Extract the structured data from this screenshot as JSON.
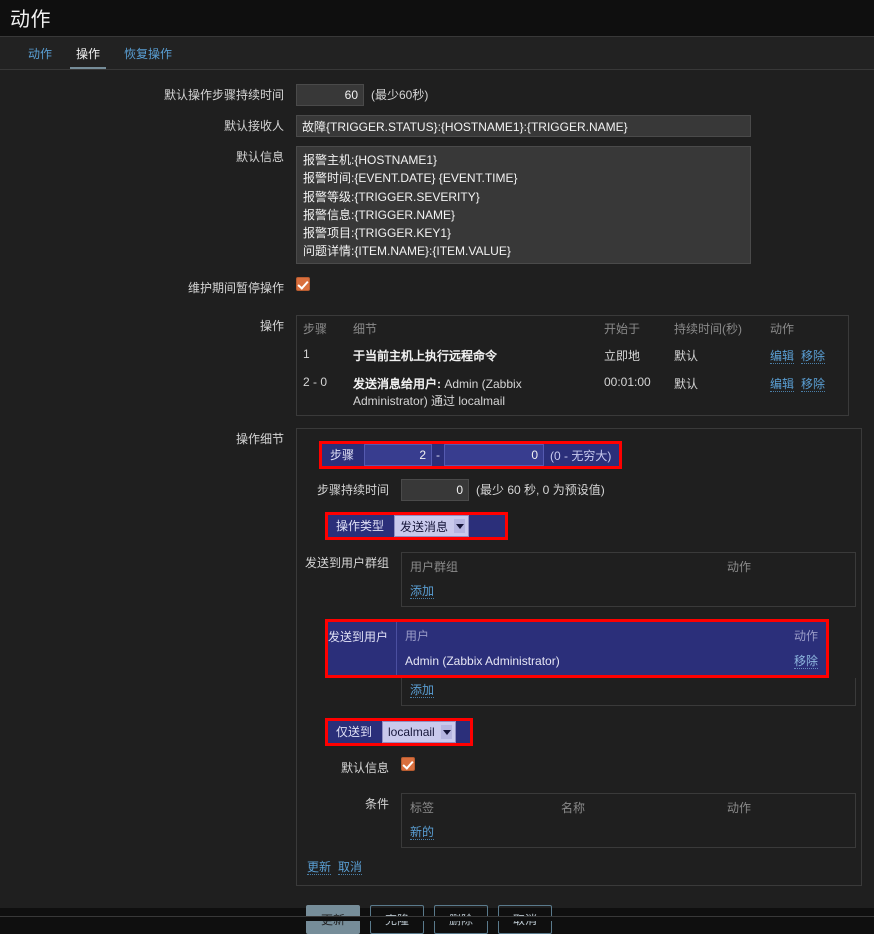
{
  "page": {
    "title": "动作"
  },
  "tabs": [
    {
      "label": "动作",
      "active": false
    },
    {
      "label": "操作",
      "active": true
    },
    {
      "label": "恢复操作",
      "active": false
    }
  ],
  "form": {
    "default_step_duration": {
      "label": "默认操作步骤持续时间",
      "value": "60",
      "hint": "(最少60秒)"
    },
    "default_subject": {
      "label": "默认接收人",
      "value": "故障{TRIGGER.STATUS}:{HOSTNAME1}:{TRIGGER.NAME}"
    },
    "default_message": {
      "label": "默认信息",
      "value": "报警主机:{HOSTNAME1}\n报警时间:{EVENT.DATE} {EVENT.TIME}\n报警等级:{TRIGGER.SEVERITY}\n报警信息:{TRIGGER.NAME}\n报警项目:{TRIGGER.KEY1}\n问题详情:{ITEM.NAME}:{ITEM.VALUE}"
    },
    "pause_maintenance": {
      "label": "维护期间暂停操作",
      "checked": true
    }
  },
  "operations": {
    "label": "操作",
    "columns": {
      "step": "步骤",
      "details": "细节",
      "start_in": "开始于",
      "duration": "持续时间(秒)",
      "action": "动作"
    },
    "rows": [
      {
        "step": "1",
        "details": "于当前主机上执行远程命令",
        "details_bold": "于当前主机上执行远程命令",
        "details_plain": "",
        "start_in": "立即地",
        "duration": "默认",
        "edit": "编辑",
        "remove": "移除"
      },
      {
        "step": "2 - 0",
        "details_bold": "发送消息给用户:",
        "details_plain": " Admin (Zabbix Administrator) 通过 localmail",
        "start_in": "00:01:00",
        "duration": "默认",
        "edit": "编辑",
        "remove": "移除"
      }
    ]
  },
  "operation_details": {
    "label": "操作细节",
    "steps": {
      "label": "步骤",
      "from": "2",
      "dash": "-",
      "to": "0",
      "hint": "(0 - 无穷大)"
    },
    "step_duration": {
      "label": "步骤持续时间",
      "value": "0",
      "hint": "(最少 60 秒, 0 为预设值)"
    },
    "operation_type": {
      "label": "操作类型",
      "value": "发送消息"
    },
    "send_to_user_groups": {
      "label": "发送到用户群组",
      "col_group": "用户群组",
      "col_action": "动作",
      "add": "添加",
      "rows": []
    },
    "send_to_users": {
      "label": "发送到用户",
      "col_user": "用户",
      "col_action": "动作",
      "add": "添加",
      "rows": [
        {
          "user": "Admin (Zabbix Administrator)",
          "action": "移除"
        }
      ]
    },
    "send_only_to": {
      "label": "仅送到",
      "value": "localmail"
    },
    "default_message": {
      "label": "默认信息",
      "checked": true
    },
    "conditions": {
      "label": "条件",
      "col_label": "标签",
      "col_name": "名称",
      "col_action": "动作",
      "new": "新的",
      "rows": []
    },
    "update_link": "更新",
    "cancel_link": "取消"
  },
  "buttons": {
    "update": "更新",
    "clone": "克隆",
    "delete": "删除",
    "cancel": "取消"
  }
}
